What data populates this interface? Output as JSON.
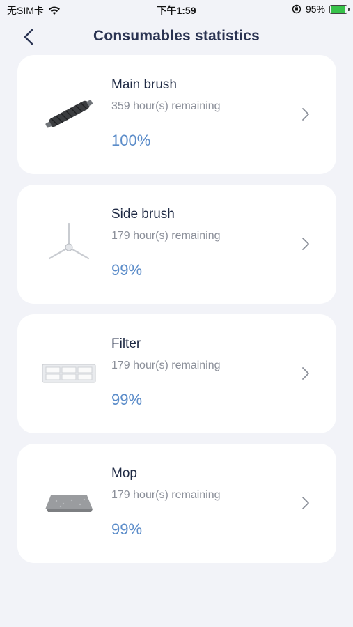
{
  "status_bar": {
    "carrier": "无SIM卡",
    "time": "下午1:59",
    "battery": "95%",
    "battery_level": 0.95,
    "icons": [
      "wifi-icon",
      "orientation-lock-icon",
      "battery-icon"
    ]
  },
  "header": {
    "title": "Consumables statistics",
    "back_icon": "back-chevron-icon"
  },
  "consumables": [
    {
      "name": "Main brush",
      "remaining": "359 hour(s) remaining",
      "percent": "100%",
      "icon": "main-brush-icon"
    },
    {
      "name": "Side brush",
      "remaining": "179 hour(s) remaining",
      "percent": "99%",
      "icon": "side-brush-icon"
    },
    {
      "name": "Filter",
      "remaining": "179 hour(s) remaining",
      "percent": "99%",
      "icon": "filter-icon"
    },
    {
      "name": "Mop",
      "remaining": "179 hour(s) remaining",
      "percent": "99%",
      "icon": "mop-icon"
    }
  ],
  "colors": {
    "background": "#f2f3f8",
    "card": "#ffffff",
    "title": "#2a3352",
    "percent": "#5b8cc9",
    "secondary_text": "#8b8f99",
    "battery_fill": "#37c24a"
  }
}
